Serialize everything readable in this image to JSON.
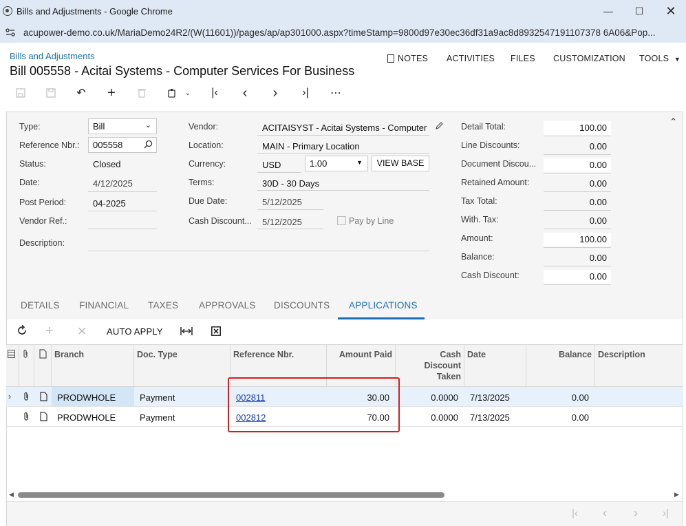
{
  "window": {
    "title": "Bills and Adjustments - Google Chrome",
    "url": "acupower-demo.co.uk/MariaDemo24R2/(W(11601))/pages/ap/ap301000.aspx?timeStamp=9800d97e30ec36df31a9ac8d8932547191107378 6A06&Pop..."
  },
  "header": {
    "breadcrumb": "Bills and Adjustments",
    "title": "Bill 005558 - Acitai Systems - Computer Services For Business",
    "menu": {
      "notes": "NOTES",
      "activities": "ACTIVITIES",
      "files": "FILES",
      "customization": "CUSTOMIZATION",
      "tools": "TOOLS"
    }
  },
  "form": {
    "type_label": "Type:",
    "type_value": "Bill",
    "refnbr_label": "Reference Nbr.:",
    "refnbr_value": "005558",
    "status_label": "Status:",
    "status_value": "Closed",
    "date_label": "Date:",
    "date_value": "4/12/2025",
    "postperiod_label": "Post Period:",
    "postperiod_value": "04-2025",
    "vendorref_label": "Vendor Ref.:",
    "vendorref_value": "",
    "description_label": "Description:",
    "description_value": "",
    "vendor_label": "Vendor:",
    "vendor_value": "ACITAISYST - Acitai Systems - Computer",
    "location_label": "Location:",
    "location_value": "MAIN - Primary Location",
    "currency_label": "Currency:",
    "currency_value": "USD",
    "rate_value": "1.00",
    "viewbase_label": "VIEW BASE",
    "terms_label": "Terms:",
    "terms_value": "30D - 30 Days",
    "duedate_label": "Due Date:",
    "duedate_value": "5/12/2025",
    "cashdisc_label": "Cash Discount...",
    "cashdisc_value": "5/12/2025",
    "paybyline_label": "Pay by Line"
  },
  "totals": [
    {
      "label": "Detail Total:",
      "value": "100.00"
    },
    {
      "label": "Line Discounts:",
      "value": "0.00"
    },
    {
      "label": "Document Discou...",
      "value": "0.00"
    },
    {
      "label": "Retained Amount:",
      "value": "0.00"
    },
    {
      "label": "Tax Total:",
      "value": "0.00"
    },
    {
      "label": "With. Tax:",
      "value": "0.00"
    },
    {
      "label": "Amount:",
      "value": "100.00"
    },
    {
      "label": "Balance:",
      "value": "0.00"
    },
    {
      "label": "Cash Discount:",
      "value": "0.00"
    }
  ],
  "tabs": [
    "DETAILS",
    "FINANCIAL",
    "TAXES",
    "APPROVALS",
    "DISCOUNTS",
    "APPLICATIONS"
  ],
  "grid": {
    "auto_apply": "AUTO APPLY",
    "columns": {
      "branch": "Branch",
      "doctype": "Doc. Type",
      "refnbr": "Reference Nbr.",
      "amountpaid": "Amount Paid",
      "cashdisc_1": "Cash",
      "cashdisc_2": "Discount",
      "cashdisc_3": "Taken",
      "date": "Date",
      "balance": "Balance",
      "description": "Description"
    },
    "rows": [
      {
        "branch": "PRODWHOLE",
        "doctype": "Payment",
        "refnbr": "002811",
        "amountpaid": "30.00",
        "cashdisc": "0.0000",
        "date": "7/13/2025",
        "balance": "0.00",
        "description": ""
      },
      {
        "branch": "PRODWHOLE",
        "doctype": "Payment",
        "refnbr": "002812",
        "amountpaid": "70.00",
        "cashdisc": "0.0000",
        "date": "7/13/2025",
        "balance": "0.00",
        "description": ""
      }
    ]
  }
}
